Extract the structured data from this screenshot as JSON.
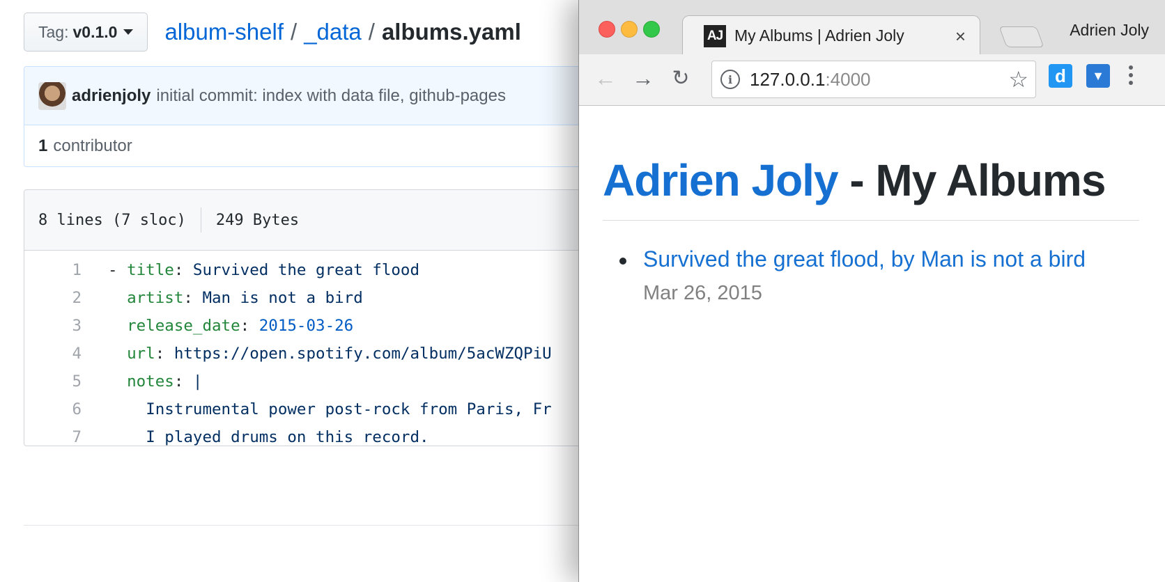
{
  "github": {
    "tag_label": "Tag:",
    "tag_value": "v0.1.0",
    "breadcrumb": {
      "repo": "album-shelf",
      "sep": "/",
      "dir": "_data",
      "file": "albums.yaml"
    },
    "commit": {
      "author": "adrienjoly",
      "message": "initial commit: index with data file, github-pages"
    },
    "contributors": {
      "count": "1",
      "label": "contributor"
    },
    "file": {
      "lines": "8 lines (7 sloc)",
      "size": "249 Bytes",
      "code": [
        {
          "n": "1",
          "pre": "- ",
          "key": "title",
          "sep": ": ",
          "val": "Survived the great flood",
          "type": "str"
        },
        {
          "n": "2",
          "pre": "  ",
          "key": "artist",
          "sep": ": ",
          "val": "Man is not a bird",
          "type": "str"
        },
        {
          "n": "3",
          "pre": "  ",
          "key": "release_date",
          "sep": ": ",
          "val": "2015-03-26",
          "type": "num"
        },
        {
          "n": "4",
          "pre": "  ",
          "key": "url",
          "sep": ": ",
          "val": "https://open.spotify.com/album/5acWZQPiU",
          "type": "str"
        },
        {
          "n": "5",
          "pre": "  ",
          "key": "notes",
          "sep": ": ",
          "val": "|",
          "type": "str"
        },
        {
          "n": "6",
          "pre": "    ",
          "key": "",
          "sep": "",
          "val": "Instrumental power post-rock from Paris, Fr",
          "type": "str"
        },
        {
          "n": "7",
          "pre": "    ",
          "key": "",
          "sep": "",
          "val": "I played drums on this record.",
          "type": "str"
        }
      ]
    }
  },
  "browser": {
    "tab_favicon": "AJ",
    "tab_title": "My Albums | Adrien Joly",
    "tab_close": "×",
    "profile": "Adrien Joly",
    "url_host": "127.0.0.1",
    "url_port": ":4000",
    "icons": [
      "back-arrow-icon",
      "forward-arrow-icon",
      "reload-icon",
      "info-icon",
      "star-icon",
      "extension-d-icon",
      "extension-pocket-icon",
      "menu-icon"
    ],
    "extension_d_glyph": "d",
    "extension_p_glyph": "▼"
  },
  "page": {
    "heading_link": "Adrien Joly",
    "heading_rest": " - My Albums",
    "albums": [
      {
        "link": "Survived the great flood, by Man is not a bird",
        "date": "Mar 26, 2015"
      }
    ]
  }
}
